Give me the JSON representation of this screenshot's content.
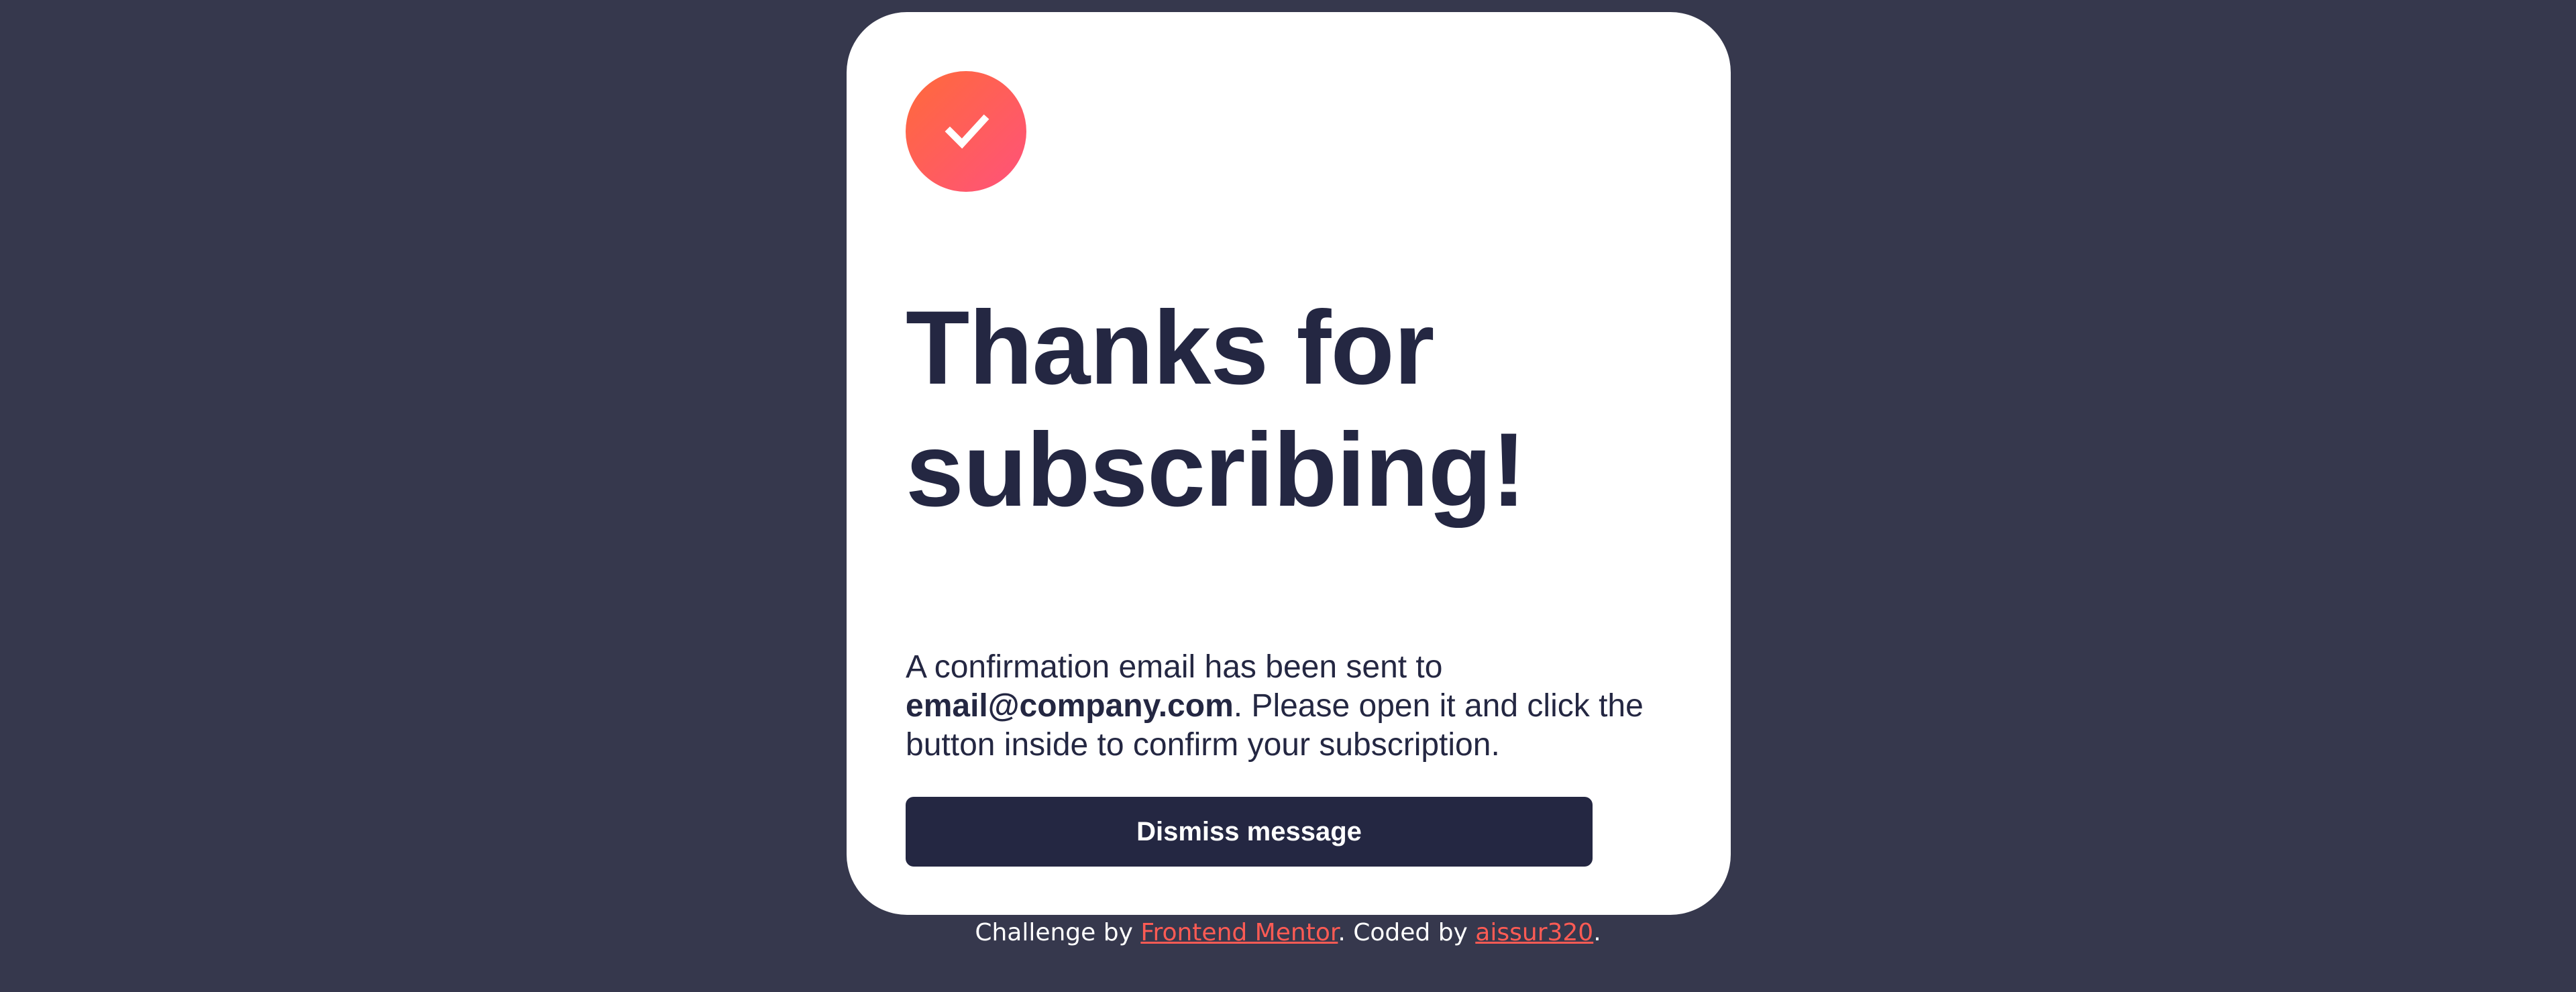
{
  "card": {
    "icon": "success-check-icon",
    "heading": "Thanks for subscribing!",
    "message": {
      "before_email": "A confirmation email has been sent to ",
      "email": "email@company.com",
      "after_email": ". Please open it and click the button inside to confirm your subscription."
    },
    "dismiss_label": "Dismiss message"
  },
  "attribution": {
    "prefix": "Challenge by ",
    "link_1": "Frontend Mentor",
    "middle": ". Coded by ",
    "link_2": "aissur320",
    "suffix": "."
  },
  "colors": {
    "page_background": "#36384d",
    "card_background": "#ffffff",
    "text_dark": "#242742",
    "button_background": "#242742",
    "link": "#ff5b54",
    "icon_gradient_start": "#ff6a3a",
    "icon_gradient_end": "#ff527b"
  }
}
